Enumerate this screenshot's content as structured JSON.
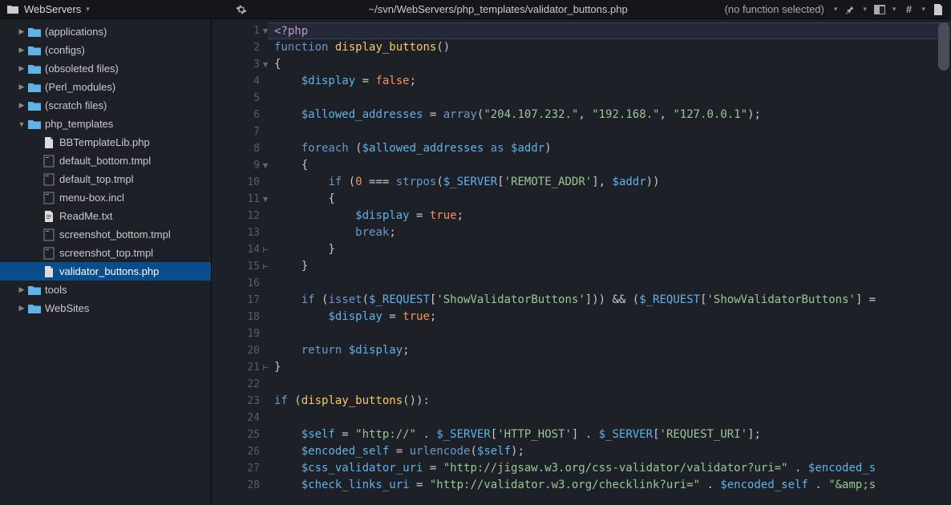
{
  "topbar": {
    "project": "WebServers",
    "path": "~/svn/WebServers/php_templates/validator_buttons.php",
    "function_selector": "(no function selected)"
  },
  "sidebar": {
    "items": [
      {
        "label": "(applications)",
        "type": "folder",
        "depth": 1,
        "expanded": false
      },
      {
        "label": "(configs)",
        "type": "folder",
        "depth": 1,
        "expanded": false
      },
      {
        "label": "(obsoleted files)",
        "type": "folder",
        "depth": 1,
        "expanded": false
      },
      {
        "label": "(Perl_modules)",
        "type": "folder",
        "depth": 1,
        "expanded": false
      },
      {
        "label": "(scratch files)",
        "type": "folder",
        "depth": 1,
        "expanded": false
      },
      {
        "label": "php_templates",
        "type": "folder",
        "depth": 1,
        "expanded": true
      },
      {
        "label": "BBTemplateLib.php",
        "type": "file-php",
        "depth": 2
      },
      {
        "label": "default_bottom.tmpl",
        "type": "file",
        "depth": 2
      },
      {
        "label": "default_top.tmpl",
        "type": "file",
        "depth": 2
      },
      {
        "label": "menu-box.incl",
        "type": "file",
        "depth": 2
      },
      {
        "label": "ReadMe.txt",
        "type": "file-txt",
        "depth": 2
      },
      {
        "label": "screenshot_bottom.tmpl",
        "type": "file",
        "depth": 2
      },
      {
        "label": "screenshot_top.tmpl",
        "type": "file",
        "depth": 2
      },
      {
        "label": "validator_buttons.php",
        "type": "file-php",
        "depth": 2,
        "selected": true
      },
      {
        "label": "tools",
        "type": "folder",
        "depth": 1,
        "expanded": false
      },
      {
        "label": "WebSites",
        "type": "folder",
        "depth": 1,
        "expanded": false
      }
    ]
  },
  "editor": {
    "first_line": 1,
    "last_line": 28,
    "fold_markers": {
      "1": "▼",
      "3": "▼",
      "9": "▼",
      "11": "▼",
      "14": "⊢",
      "15": "⊢",
      "21": "⊢"
    },
    "lines": [
      {
        "n": 1,
        "tokens": [
          [
            "k",
            "<?php"
          ]
        ]
      },
      {
        "n": 2,
        "tokens": [
          [
            "kw2",
            "function"
          ],
          [
            "p",
            " "
          ],
          [
            "fn",
            "display_buttons"
          ],
          [
            "p",
            "()"
          ]
        ]
      },
      {
        "n": 3,
        "tokens": [
          [
            "p",
            "{"
          ]
        ]
      },
      {
        "n": 4,
        "tokens": [
          [
            "p",
            "    "
          ],
          [
            "v",
            "$display"
          ],
          [
            "p",
            " = "
          ],
          [
            "n",
            "false"
          ],
          [
            "p",
            ";"
          ]
        ]
      },
      {
        "n": 5,
        "tokens": []
      },
      {
        "n": 6,
        "tokens": [
          [
            "p",
            "    "
          ],
          [
            "v",
            "$allowed_addresses"
          ],
          [
            "p",
            " = "
          ],
          [
            "bi",
            "array"
          ],
          [
            "p",
            "("
          ],
          [
            "s",
            "\"204.107.232.\""
          ],
          [
            "p",
            ", "
          ],
          [
            "s",
            "\"192.168.\""
          ],
          [
            "p",
            ", "
          ],
          [
            "s",
            "\"127.0.0.1\""
          ],
          [
            "p",
            ");"
          ]
        ]
      },
      {
        "n": 7,
        "tokens": []
      },
      {
        "n": 8,
        "tokens": [
          [
            "p",
            "    "
          ],
          [
            "kw2",
            "foreach"
          ],
          [
            "p",
            " ("
          ],
          [
            "v",
            "$allowed_addresses"
          ],
          [
            "p",
            " "
          ],
          [
            "kw2",
            "as"
          ],
          [
            "p",
            " "
          ],
          [
            "v",
            "$addr"
          ],
          [
            "p",
            ")"
          ]
        ]
      },
      {
        "n": 9,
        "tokens": [
          [
            "p",
            "    {"
          ]
        ]
      },
      {
        "n": 10,
        "tokens": [
          [
            "p",
            "        "
          ],
          [
            "kw2",
            "if"
          ],
          [
            "p",
            " ("
          ],
          [
            "n",
            "0"
          ],
          [
            "p",
            " === "
          ],
          [
            "bi",
            "strpos"
          ],
          [
            "p",
            "("
          ],
          [
            "v",
            "$_SERVER"
          ],
          [
            "p",
            "["
          ],
          [
            "s",
            "'REMOTE_ADDR'"
          ],
          [
            "p",
            "], "
          ],
          [
            "v",
            "$addr"
          ],
          [
            "p",
            "))"
          ]
        ]
      },
      {
        "n": 11,
        "tokens": [
          [
            "p",
            "        {"
          ]
        ]
      },
      {
        "n": 12,
        "tokens": [
          [
            "p",
            "            "
          ],
          [
            "v",
            "$display"
          ],
          [
            "p",
            " = "
          ],
          [
            "n",
            "true"
          ],
          [
            "p",
            ";"
          ]
        ]
      },
      {
        "n": 13,
        "tokens": [
          [
            "p",
            "            "
          ],
          [
            "kw2",
            "break"
          ],
          [
            "p",
            ";"
          ]
        ]
      },
      {
        "n": 14,
        "tokens": [
          [
            "p",
            "        }"
          ]
        ]
      },
      {
        "n": 15,
        "tokens": [
          [
            "p",
            "    }"
          ]
        ]
      },
      {
        "n": 16,
        "tokens": []
      },
      {
        "n": 17,
        "tokens": [
          [
            "p",
            "    "
          ],
          [
            "kw2",
            "if"
          ],
          [
            "p",
            " ("
          ],
          [
            "bi",
            "isset"
          ],
          [
            "p",
            "("
          ],
          [
            "v",
            "$_REQUEST"
          ],
          [
            "p",
            "["
          ],
          [
            "s",
            "'ShowValidatorButtons'"
          ],
          [
            "p",
            "])) && ("
          ],
          [
            "v",
            "$_REQUEST"
          ],
          [
            "p",
            "["
          ],
          [
            "s",
            "'ShowValidatorButtons'"
          ],
          [
            "p",
            "] ="
          ]
        ]
      },
      {
        "n": 18,
        "tokens": [
          [
            "p",
            "        "
          ],
          [
            "v",
            "$display"
          ],
          [
            "p",
            " = "
          ],
          [
            "n",
            "true"
          ],
          [
            "p",
            ";"
          ]
        ]
      },
      {
        "n": 19,
        "tokens": []
      },
      {
        "n": 20,
        "tokens": [
          [
            "p",
            "    "
          ],
          [
            "kw2",
            "return"
          ],
          [
            "p",
            " "
          ],
          [
            "v",
            "$display"
          ],
          [
            "p",
            ";"
          ]
        ]
      },
      {
        "n": 21,
        "tokens": [
          [
            "p",
            "}"
          ]
        ]
      },
      {
        "n": 22,
        "tokens": []
      },
      {
        "n": 23,
        "tokens": [
          [
            "kw2",
            "if"
          ],
          [
            "p",
            " ("
          ],
          [
            "fn",
            "display_buttons"
          ],
          [
            "p",
            "()):"
          ]
        ]
      },
      {
        "n": 24,
        "tokens": []
      },
      {
        "n": 25,
        "tokens": [
          [
            "p",
            "    "
          ],
          [
            "v",
            "$self"
          ],
          [
            "p",
            " = "
          ],
          [
            "s",
            "\"http://\""
          ],
          [
            "p",
            " . "
          ],
          [
            "v",
            "$_SERVER"
          ],
          [
            "p",
            "["
          ],
          [
            "s",
            "'HTTP_HOST'"
          ],
          [
            "p",
            "] . "
          ],
          [
            "v",
            "$_SERVER"
          ],
          [
            "p",
            "["
          ],
          [
            "s",
            "'REQUEST_URI'"
          ],
          [
            "p",
            "];"
          ]
        ]
      },
      {
        "n": 26,
        "tokens": [
          [
            "p",
            "    "
          ],
          [
            "v",
            "$encoded_self"
          ],
          [
            "p",
            " = "
          ],
          [
            "bi",
            "urlencode"
          ],
          [
            "p",
            "("
          ],
          [
            "v",
            "$self"
          ],
          [
            "p",
            ");"
          ]
        ]
      },
      {
        "n": 27,
        "tokens": [
          [
            "p",
            "    "
          ],
          [
            "v",
            "$css_validator_uri"
          ],
          [
            "p",
            " = "
          ],
          [
            "s",
            "\"http://jigsaw.w3.org/css-validator/validator?uri=\""
          ],
          [
            "p",
            " . "
          ],
          [
            "v",
            "$encoded_s"
          ]
        ]
      },
      {
        "n": 28,
        "tokens": [
          [
            "p",
            "    "
          ],
          [
            "v",
            "$check_links_uri"
          ],
          [
            "p",
            " = "
          ],
          [
            "s",
            "\"http://validator.w3.org/checklink?uri=\""
          ],
          [
            "p",
            " . "
          ],
          [
            "v",
            "$encoded_self"
          ],
          [
            "p",
            " . "
          ],
          [
            "s",
            "\"&amp;s"
          ]
        ]
      }
    ]
  }
}
